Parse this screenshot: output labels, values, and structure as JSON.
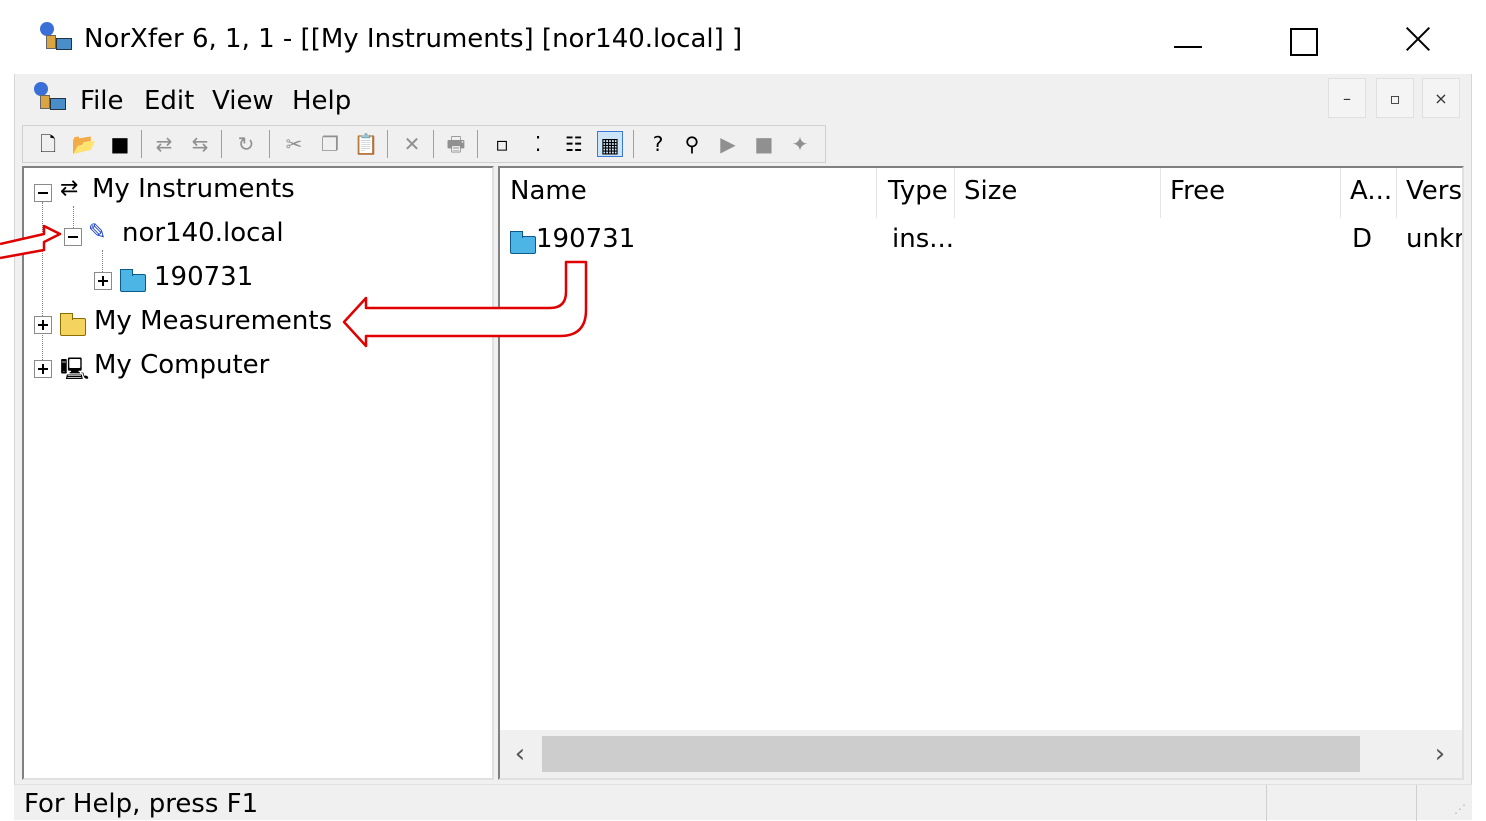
{
  "window": {
    "title": "NorXfer 6, 1, 1 - [[My Instruments] [nor140.local] ]"
  },
  "menu": {
    "items": [
      "File",
      "Edit",
      "View",
      "Help"
    ],
    "mdi_min": "–",
    "mdi_restore": "▫",
    "mdi_close": "×"
  },
  "toolbar": {
    "icons": [
      "new-icon",
      "open-icon",
      "save-icon",
      "connect-icon",
      "disconnect-icon",
      "refresh-icon",
      "cut-icon",
      "copy-icon",
      "paste-icon",
      "delete-icon",
      "print-icon",
      "large-icons-icon",
      "small-icons-icon",
      "list-view-icon",
      "details-view-icon",
      "help-icon",
      "context-help-icon",
      "play-icon",
      "stop-icon",
      "plugin-icon"
    ]
  },
  "tree": {
    "root": "My Instruments",
    "instrument": "nor140.local",
    "folder": "190731",
    "measurements": "My Measurements",
    "computer": "My Computer"
  },
  "list": {
    "columns": [
      "Name",
      "Type",
      "Size",
      "Free",
      "A...",
      "Versi"
    ],
    "rows": [
      {
        "name": "190731",
        "type": "ins...",
        "size": "",
        "free": "",
        "attr": "D",
        "version": "unkr"
      }
    ],
    "scroll_left": "‹",
    "scroll_right": "›"
  },
  "status": {
    "text": "For Help, press F1"
  },
  "colors": {
    "annotation_arrow": "#e00000",
    "folder": "#4db5e6",
    "selected_view": "#cce4f7"
  }
}
